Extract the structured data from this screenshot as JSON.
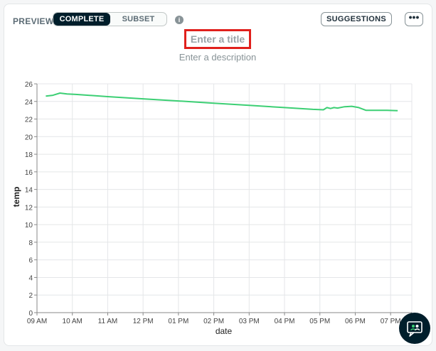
{
  "toolbar": {
    "preview_label": "PREVIEW",
    "mode_complete": "COMPLETE",
    "mode_subset": "SUBSET",
    "info_glyph": "i",
    "suggestions_label": "SUGGESTIONS",
    "more_glyph": "•••"
  },
  "chart_header": {
    "title_placeholder": "Enter a title",
    "description_placeholder": "Enter a description"
  },
  "colors": {
    "series": "#3ccf74",
    "grid": "#e4e6e8",
    "highlight": "#e0201c",
    "active_segment": "#001e2b"
  },
  "chart_data": {
    "type": "line",
    "xlabel": "date",
    "ylabel": "temp",
    "x_ticks": [
      "09 AM",
      "10 AM",
      "11 AM",
      "12 PM",
      "01 PM",
      "02 PM",
      "03 PM",
      "04 PM",
      "05 PM",
      "06 PM",
      "07 PM"
    ],
    "y_ticks": [
      0,
      2,
      4,
      6,
      8,
      10,
      12,
      14,
      16,
      18,
      20,
      22,
      24,
      26
    ],
    "ylim": [
      0,
      26
    ],
    "xlim_hours": [
      9,
      19.6
    ],
    "grid": true,
    "series": [
      {
        "x": [
          9.25,
          9.45,
          9.65,
          9.85,
          10.1,
          11,
          12,
          13,
          14,
          15,
          16,
          16.8,
          17.1,
          17.2,
          17.3,
          17.4,
          17.5,
          17.7,
          17.9,
          18.1,
          18.3,
          18.6,
          18.9,
          19.2
        ],
        "y": [
          24.6,
          24.7,
          24.95,
          24.85,
          24.8,
          24.55,
          24.3,
          24.05,
          23.8,
          23.55,
          23.3,
          23.1,
          23.05,
          23.3,
          23.2,
          23.3,
          23.25,
          23.4,
          23.45,
          23.3,
          23.0,
          23.0,
          23.0,
          22.95
        ]
      }
    ]
  },
  "fab": {
    "icon": "chat-assistant-icon"
  }
}
